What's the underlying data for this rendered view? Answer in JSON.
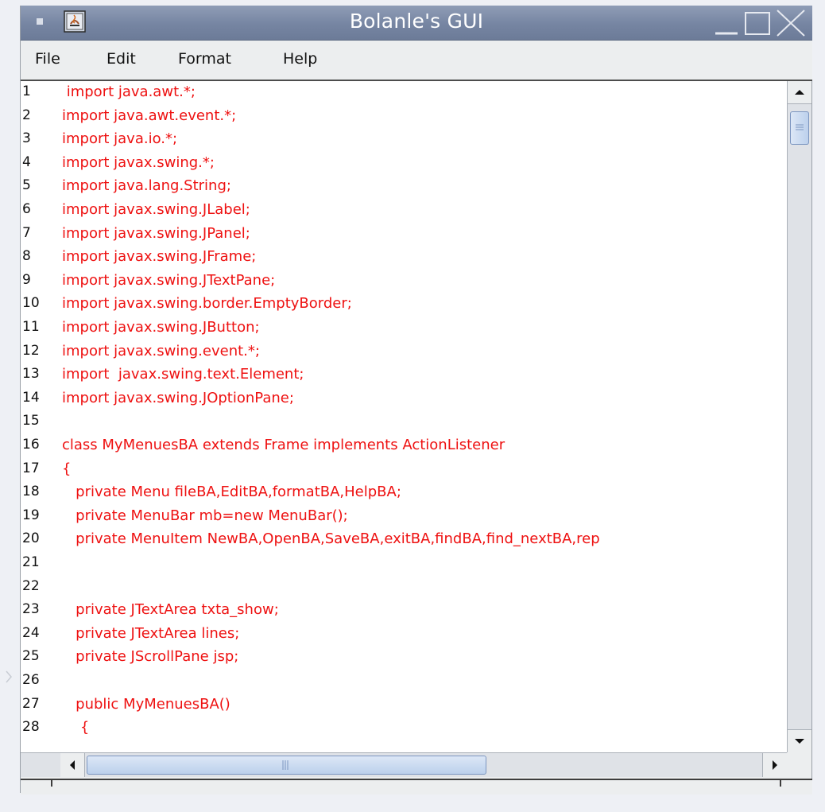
{
  "window": {
    "title": "Bolanle's GUI"
  },
  "menubar": {
    "items": [
      "File",
      "Edit",
      "Format",
      "Help"
    ]
  },
  "editor": {
    "lines": [
      {
        "num": "1",
        "text": " import java.awt.*;"
      },
      {
        "num": "2",
        "text": "import java.awt.event.*;"
      },
      {
        "num": "3",
        "text": "import java.io.*;"
      },
      {
        "num": "4",
        "text": "import javax.swing.*;"
      },
      {
        "num": "5",
        "text": "import java.lang.String;"
      },
      {
        "num": "6",
        "text": "import javax.swing.JLabel;"
      },
      {
        "num": "7",
        "text": "import javax.swing.JPanel;"
      },
      {
        "num": "8",
        "text": "import javax.swing.JFrame;"
      },
      {
        "num": "9",
        "text": "import javax.swing.JTextPane;"
      },
      {
        "num": "10",
        "text": "import javax.swing.border.EmptyBorder;"
      },
      {
        "num": "11",
        "text": "import javax.swing.JButton;"
      },
      {
        "num": "12",
        "text": "import javax.swing.event.*;"
      },
      {
        "num": "13",
        "text": "import  javax.swing.text.Element;"
      },
      {
        "num": "14",
        "text": "import javax.swing.JOptionPane;"
      },
      {
        "num": "15",
        "text": ""
      },
      {
        "num": "16",
        "text": "class MyMenuesBA extends Frame implements ActionListener"
      },
      {
        "num": "17",
        "text": "{"
      },
      {
        "num": "18",
        "text": "   private Menu fileBA,EditBA,formatBA,HelpBA;"
      },
      {
        "num": "19",
        "text": "   private MenuBar mb=new MenuBar();"
      },
      {
        "num": "20",
        "text": "   private MenuItem NewBA,OpenBA,SaveBA,exitBA,findBA,find_nextBA,rep"
      },
      {
        "num": "21",
        "text": ""
      },
      {
        "num": "22",
        "text": ""
      },
      {
        "num": "23",
        "text": "   private JTextArea txta_show;"
      },
      {
        "num": "24",
        "text": "   private JTextArea lines;"
      },
      {
        "num": "25",
        "text": "   private JScrollPane jsp;"
      },
      {
        "num": "26",
        "text": ""
      },
      {
        "num": "27",
        "text": "   public MyMenuesBA()"
      },
      {
        "num": "28",
        "text": "    {"
      }
    ]
  },
  "colors": {
    "code": "#ee1111",
    "title_bar": "#7685a2",
    "scroll_thumb": "#c7d8f0"
  },
  "icons": {
    "window_menu": "square-icon",
    "app": "java-app-icon",
    "minimize": "minimize-icon",
    "maximize": "maximize-icon",
    "close": "close-icon"
  }
}
